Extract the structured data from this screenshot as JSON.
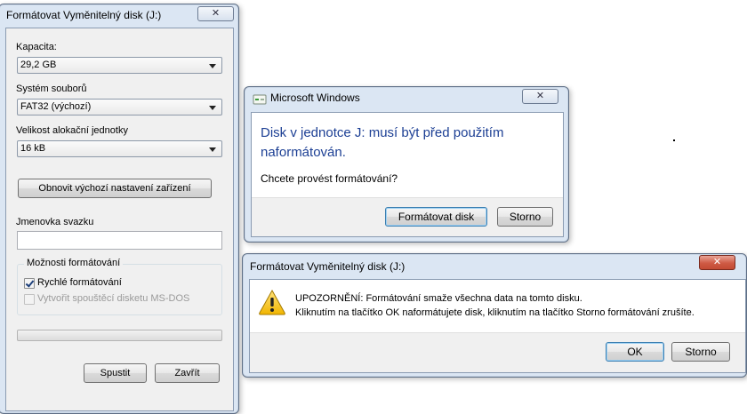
{
  "format_window": {
    "title": "Formátovat Vyměnitelný disk (J:)",
    "capacity_label": "Kapacita:",
    "capacity_value": "29,2 GB",
    "filesystem_label": "Systém souborů",
    "filesystem_value": "FAT32 (výchozí)",
    "alloc_label": "Velikost alokační jednotky",
    "alloc_value": "16 kB",
    "restore_defaults_label": "Obnovit výchozí nastavení zařízení",
    "volume_label_caption": "Jmenovka svazku",
    "volume_label_value": "",
    "format_options_title": "Možnosti formátování",
    "quick_format_label": "Rychlé formátování",
    "quick_format_checked": true,
    "msdos_label": "Vytvořit spouštěcí disketu MS-DOS",
    "msdos_checked": false,
    "progress": 0,
    "start_label": "Spustit",
    "close_label": "Zavřít",
    "close_glyph": "✕"
  },
  "msw_dialog": {
    "title": "Microsoft Windows",
    "heading": "Disk v jednotce J: musí být před použitím naformátován.",
    "question": "Chcete provést formátování?",
    "format_button_label": "Formátovat disk",
    "cancel_button_label": "Storno",
    "close_glyph": "✕"
  },
  "warning_dialog": {
    "title": "Formátovat Vyměnitelný disk (J:)",
    "warning_line1": "UPOZORNĚNÍ: Formátování smaže všechna data na tomto disku.",
    "warning_line2": "Kliknutím na tlačítko OK naformátujete disk, kliknutím na tlačítko Storno formátování zrušíte.",
    "ok_button_label": "OK",
    "cancel_button_label": "Storno",
    "close_glyph": "✕"
  },
  "icons": {
    "warning": "warning-icon",
    "drive": "drive-icon"
  },
  "colors": {
    "heading_blue": "#1c3f94",
    "window_frame": "#dbe6f3",
    "close_red": "#c24a33"
  }
}
